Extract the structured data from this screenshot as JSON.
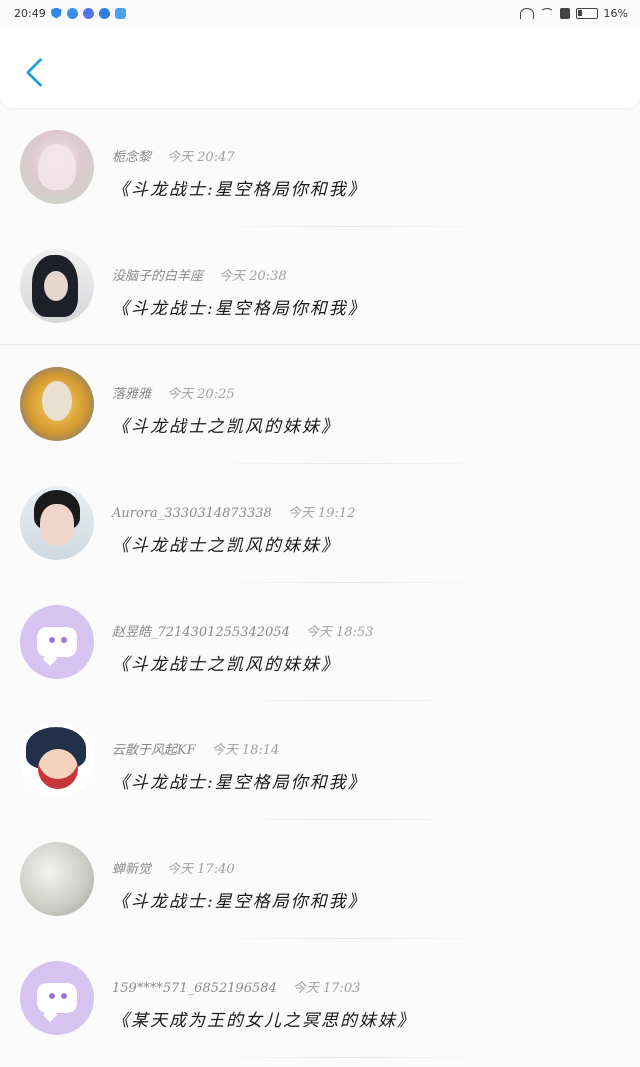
{
  "status_bar": {
    "time": "20:49",
    "battery": "16%"
  },
  "header": {
    "back_icon": "chevron-left-icon",
    "accent_color": "#1f9ce0"
  },
  "messages": [
    {
      "name": "栀念黎",
      "time": "今天 20:47",
      "text": "《斗龙战士:星空格局你和我》",
      "avatar": "anime-girl-avatar"
    },
    {
      "name": "没脑子的白羊座",
      "time": "今天 20:38",
      "text": "《斗龙战士:星空格局你和我》",
      "avatar": "girl-selfie-avatar"
    },
    {
      "name": "落雅雅",
      "time": "今天 20:25",
      "text": "《斗龙战士之凯风的妹妹》",
      "avatar": "game-hero-avatar"
    },
    {
      "name": "Aurora_3330314873338",
      "time": "今天 19:12",
      "text": "《斗龙战士之凯风的妹妹》",
      "avatar": "boy-photo-avatar"
    },
    {
      "name": "赵昱皓_7214301255342054",
      "time": "今天 18:53",
      "text": "《斗龙战士之凯风的妹妹》",
      "avatar": "default-purple-avatar"
    },
    {
      "name": "云散于风起KF",
      "time": "今天 18:14",
      "text": "《斗龙战士:星空格局你和我》",
      "avatar": "cartoon-avatar"
    },
    {
      "name": "蝉新觉",
      "time": "今天 17:40",
      "text": "《斗龙战士:星空格局你和我》",
      "avatar": "misty-photo-avatar"
    },
    {
      "name": "159****571_6852196584",
      "time": "今天 17:03",
      "text": "《某天成为王的女儿之冥思的妹妹》",
      "avatar": "default-purple-avatar"
    }
  ]
}
